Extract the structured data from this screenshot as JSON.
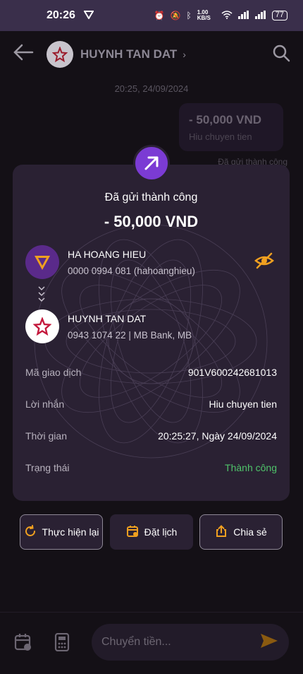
{
  "status_bar": {
    "time": "20:26",
    "net_speed": "1.00 KB/S",
    "battery": "77"
  },
  "header": {
    "contact_name": "HUYNH TAN DAT"
  },
  "chat": {
    "timestamp": "20:25, 24/09/2024",
    "bubble_amount": "- 50,000 VND",
    "bubble_message": "Hiu chuyen tien",
    "bubble_status": "Đã gửi thành công"
  },
  "receipt": {
    "title": "Đã gửi thành công",
    "amount": "- 50,000 VND",
    "sender": {
      "name": "HA HOANG HIEU",
      "account": "0000 0994 081 (hahoanghieu)"
    },
    "receiver": {
      "name": "HUYNH TAN DAT",
      "account": "0943 1074 22 | MB Bank, MB"
    },
    "details": {
      "tx_label": "Mã giao dịch",
      "tx_value": "901V600242681013",
      "msg_label": "Lời nhắn",
      "msg_value": "Hiu chuyen tien",
      "time_label": "Thời gian",
      "time_value": "20:25:27, Ngày 24/09/2024",
      "status_label": "Trạng thái",
      "status_value": "Thành công"
    },
    "colors": {
      "success": "#4fc36a",
      "accent": "#7b3bd4",
      "eye": "#f0a020"
    }
  },
  "actions": {
    "repeat": "Thực hiện lại",
    "schedule": "Đặt lịch",
    "share": "Chia sẻ"
  },
  "composer": {
    "placeholder": "Chuyển tiền..."
  }
}
